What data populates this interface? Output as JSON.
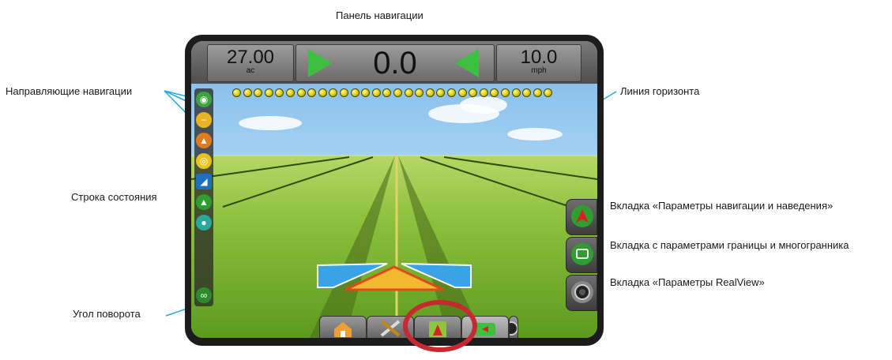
{
  "callouts": {
    "nav_panel": "Панель навигации",
    "nav_guides": "Направляющие навигации",
    "horizon": "Линия горизонта",
    "status_bar": "Строка состояния",
    "nav_guidance_tab": "Вкладка «Параметры навигации и наведения»",
    "boundary_tab": "Вкладка с параметрами границы и многогранника",
    "realview_tab": "Вкладка «Параметры RealView»",
    "steering_angle": "Угол поворота"
  },
  "navbar": {
    "area_value": "27.00",
    "area_unit": "ac",
    "cross_track_value": "0.0",
    "speed_value": "10.0",
    "speed_unit": "mph"
  },
  "lightbar": {
    "led_count": 30,
    "color": "#d6c800"
  },
  "sidebar": {
    "icons": [
      "guidance-icon",
      "line-icon",
      "gps-icon",
      "boom-icon",
      "section-icon",
      "tilt-icon",
      "droplet-icon",
      "assist-icon"
    ]
  },
  "right_tabs": [
    "nav-guidance-icon",
    "boundary-icon",
    "camera-icon"
  ],
  "bottom_tabs": [
    "home-icon",
    "tools-icon",
    "vehicle-view-icon",
    "field-view-icon",
    "realview-icon"
  ],
  "colors": {
    "accent_red": "#c8282f",
    "led_yellow": "#d6c800",
    "arrow_green": "#3fbf3f"
  }
}
